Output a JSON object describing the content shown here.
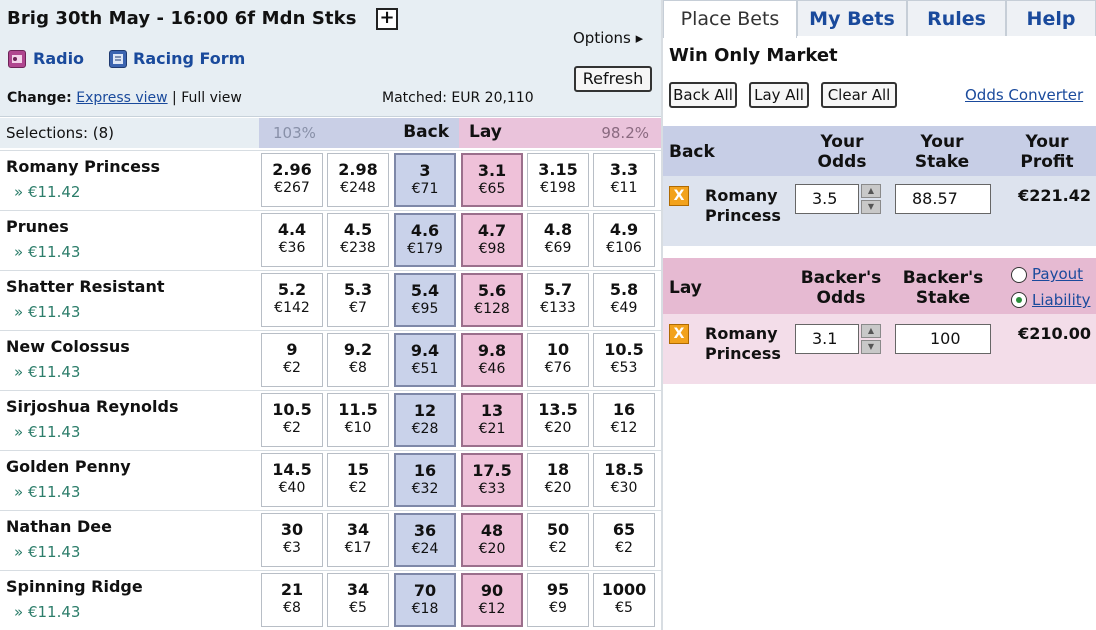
{
  "race": {
    "title": "Brig 30th May - 16:00 6f Mdn Stks",
    "plus_label": "+",
    "radio_label": "Radio",
    "racing_form_label": "Racing Form",
    "options_label": "Options",
    "options_arrow": "▸",
    "refresh_label": "Refresh",
    "change_label": "Change:",
    "express_view": "Express view",
    "separator": "|",
    "full_view": "Full view",
    "matched": "Matched: EUR 20,110"
  },
  "selections": {
    "label": "Selections: (8)",
    "back_pct": "103%",
    "back_word": "Back",
    "lay_word": "Lay",
    "lay_pct": "98.2%"
  },
  "runners": [
    {
      "name": "Romany Princess",
      "pl": "» €11.42",
      "prices": [
        [
          "2.96",
          "€267"
        ],
        [
          "2.98",
          "€248"
        ],
        [
          "3",
          "€71"
        ],
        [
          "3.1",
          "€65"
        ],
        [
          "3.15",
          "€198"
        ],
        [
          "3.3",
          "€11"
        ]
      ]
    },
    {
      "name": "Prunes",
      "pl": "» €11.43",
      "prices": [
        [
          "4.4",
          "€36"
        ],
        [
          "4.5",
          "€238"
        ],
        [
          "4.6",
          "€179"
        ],
        [
          "4.7",
          "€98"
        ],
        [
          "4.8",
          "€69"
        ],
        [
          "4.9",
          "€106"
        ]
      ]
    },
    {
      "name": "Shatter Resistant",
      "pl": "» €11.43",
      "prices": [
        [
          "5.2",
          "€142"
        ],
        [
          "5.3",
          "€7"
        ],
        [
          "5.4",
          "€95"
        ],
        [
          "5.6",
          "€128"
        ],
        [
          "5.7",
          "€133"
        ],
        [
          "5.8",
          "€49"
        ]
      ]
    },
    {
      "name": "New Colossus",
      "pl": "» €11.43",
      "prices": [
        [
          "9",
          "€2"
        ],
        [
          "9.2",
          "€8"
        ],
        [
          "9.4",
          "€51"
        ],
        [
          "9.8",
          "€46"
        ],
        [
          "10",
          "€76"
        ],
        [
          "10.5",
          "€53"
        ]
      ]
    },
    {
      "name": "Sirjoshua Reynolds",
      "pl": "» €11.43",
      "prices": [
        [
          "10.5",
          "€2"
        ],
        [
          "11.5",
          "€10"
        ],
        [
          "12",
          "€28"
        ],
        [
          "13",
          "€21"
        ],
        [
          "13.5",
          "€20"
        ],
        [
          "16",
          "€12"
        ]
      ]
    },
    {
      "name": "Golden Penny",
      "pl": "» €11.43",
      "prices": [
        [
          "14.5",
          "€40"
        ],
        [
          "15",
          "€2"
        ],
        [
          "16",
          "€32"
        ],
        [
          "17.5",
          "€33"
        ],
        [
          "18",
          "€20"
        ],
        [
          "18.5",
          "€30"
        ]
      ]
    },
    {
      "name": "Nathan Dee",
      "pl": "» €11.43",
      "prices": [
        [
          "30",
          "€3"
        ],
        [
          "34",
          "€17"
        ],
        [
          "36",
          "€24"
        ],
        [
          "48",
          "€20"
        ],
        [
          "50",
          "€2"
        ],
        [
          "65",
          "€2"
        ]
      ]
    },
    {
      "name": "Spinning Ridge",
      "pl": "» €11.43",
      "prices": [
        [
          "21",
          "€8"
        ],
        [
          "34",
          "€5"
        ],
        [
          "70",
          "€18"
        ],
        [
          "90",
          "€12"
        ],
        [
          "95",
          "€9"
        ],
        [
          "1000",
          "€5"
        ]
      ]
    }
  ],
  "tabs": {
    "place_bets": "Place Bets",
    "my_bets": "My Bets",
    "rules": "Rules",
    "help": "Help"
  },
  "betslip": {
    "market": "Win Only Market",
    "back_all": "Back All",
    "lay_all": "Lay All",
    "clear_all": "Clear All",
    "odds_converter": "Odds Converter",
    "back": {
      "title": "Back",
      "col_odds_1": "Your",
      "col_odds_2": "Odds",
      "col_stake_1": "Your",
      "col_stake_2": "Stake",
      "col_profit_1": "Your",
      "col_profit_2": "Profit",
      "name_1": "Romany",
      "name_2": "Princess",
      "odds": "3.5",
      "stake": "88.57",
      "profit": "€221.42"
    },
    "lay": {
      "title": "Lay",
      "col_odds_1": "Backer's",
      "col_odds_2": "Odds",
      "col_stake_1": "Backer's",
      "col_stake_2": "Stake",
      "payout": "Payout",
      "liability": "Liability",
      "name_1": "Romany",
      "name_2": "Princess",
      "odds": "3.1",
      "stake": "100",
      "liability_value": "€210.00"
    },
    "remove_icon": "X"
  },
  "colors": {
    "back": "#c9d2ea",
    "lay": "#efc1d9",
    "link": "#1a4a9c",
    "accent": "#f2a21c"
  }
}
